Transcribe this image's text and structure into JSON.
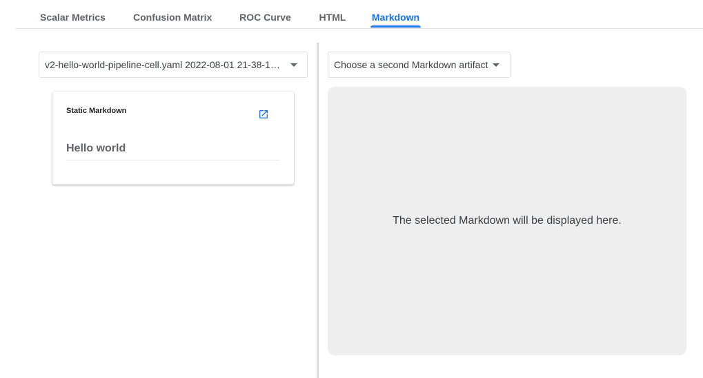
{
  "tabs": [
    {
      "label": "Scalar Metrics",
      "active": false
    },
    {
      "label": "Confusion Matrix",
      "active": false
    },
    {
      "label": "ROC Curve",
      "active": false
    },
    {
      "label": "HTML",
      "active": false
    },
    {
      "label": "Markdown",
      "active": true
    }
  ],
  "left_panel": {
    "artifact_select": {
      "selected_value": "v2-hello-world-pipeline-cell.yaml 2022-08-01 21-38-1…"
    },
    "card": {
      "title": "Static Markdown",
      "open_icon": "open-in-new-icon",
      "content_heading": "Hello world"
    }
  },
  "right_panel": {
    "artifact_select": {
      "placeholder": "Choose a second Markdown artifact"
    },
    "placeholder_text": "The selected Markdown will be displayed here."
  },
  "colors": {
    "accent": "#1a73e8",
    "tab_inactive": "#5f6368",
    "panel_background": "#eeeeee",
    "divider": "#dadce0"
  }
}
